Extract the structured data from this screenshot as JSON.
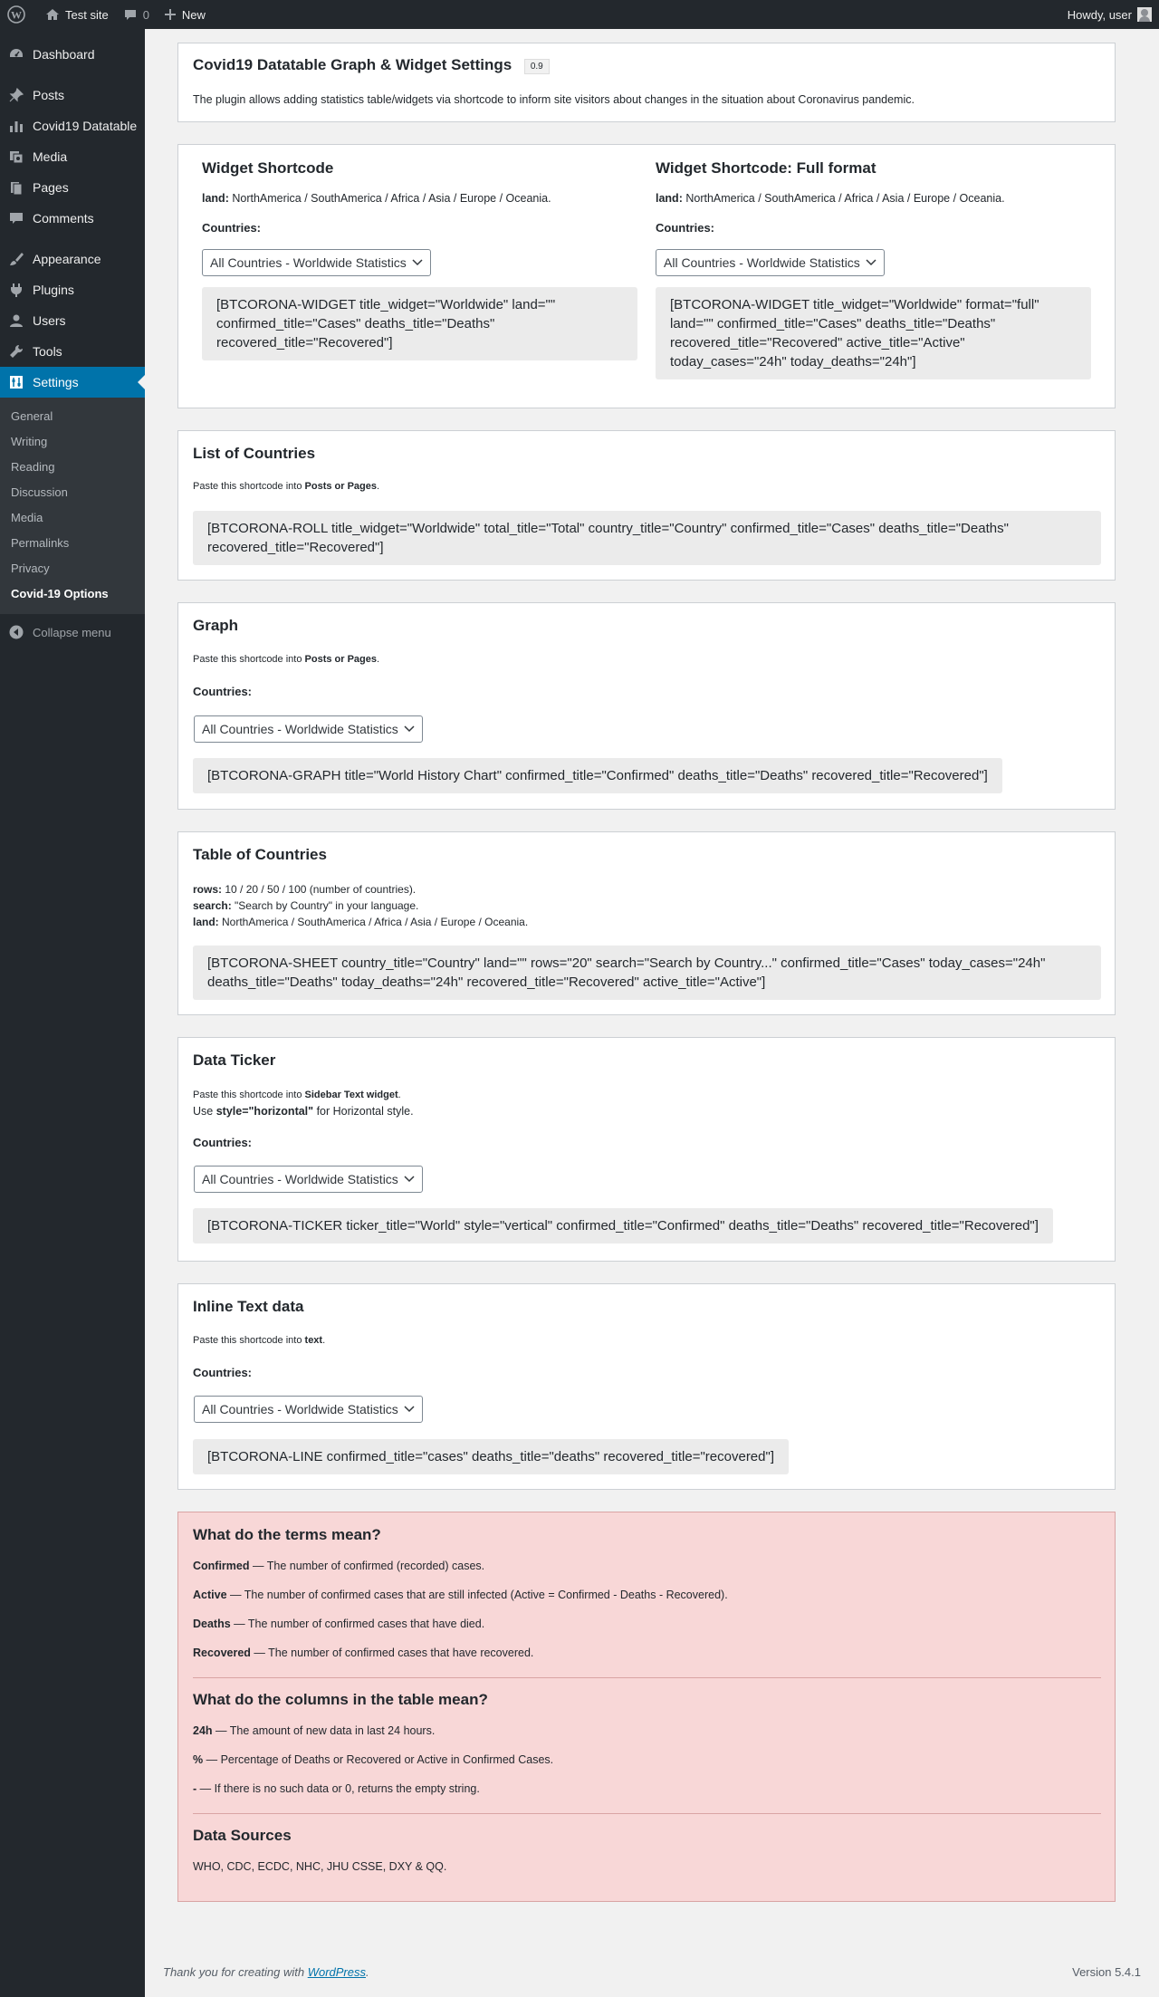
{
  "adminbar": {
    "site_name": "Test site",
    "comments_count": "0",
    "new_label": "New",
    "howdy": "Howdy, user"
  },
  "sidebar": {
    "items": [
      {
        "label": "Dashboard",
        "icon": "dashboard-icon"
      },
      {
        "label": "Posts",
        "icon": "pushpin-icon"
      },
      {
        "label": "Covid19 Datatable",
        "icon": "chart-bar-icon"
      },
      {
        "label": "Media",
        "icon": "media-icon"
      },
      {
        "label": "Pages",
        "icon": "page-icon"
      },
      {
        "label": "Comments",
        "icon": "comment-icon"
      },
      {
        "label": "Appearance",
        "icon": "paintbrush-icon"
      },
      {
        "label": "Plugins",
        "icon": "plugin-icon"
      },
      {
        "label": "Users",
        "icon": "user-icon"
      },
      {
        "label": "Tools",
        "icon": "wrench-icon"
      },
      {
        "label": "Settings",
        "icon": "settings-icon"
      }
    ],
    "submenu": [
      "General",
      "Writing",
      "Reading",
      "Discussion",
      "Media",
      "Permalinks",
      "Privacy",
      "Covid-19 Options"
    ],
    "collapse_label": "Collapse menu"
  },
  "header": {
    "title": "Covid19 Datatable Graph & Widget Settings",
    "version": "0.9",
    "description": "The plugin allows adding statistics table/widgets via shortcode to inform site visitors about changes in the situation about Coronavirus pandemic."
  },
  "common": {
    "land_label": "land:",
    "land_values": "NorthAmerica / SouthAmerica / Africa / Asia / Europe / Oceania.",
    "countries_label": "Countries:",
    "select_value": "All Countries - Worldwide Statistics",
    "paste_prefix": "Paste this shortcode into",
    "posts_or_pages": "Posts or Pages"
  },
  "widget": {
    "title": "Widget Shortcode",
    "code": "[BTCORONA-WIDGET title_widget=\"Worldwide\" land=\"\" confirmed_title=\"Cases\" deaths_title=\"Deaths\" recovered_title=\"Recovered\"]"
  },
  "widget_full": {
    "title": "Widget Shortcode: Full format",
    "code": "[BTCORONA-WIDGET title_widget=\"Worldwide\" format=\"full\" land=\"\" confirmed_title=\"Cases\" deaths_title=\"Deaths\" recovered_title=\"Recovered\" active_title=\"Active\" today_cases=\"24h\" today_deaths=\"24h\"]"
  },
  "roll": {
    "title": "List of Countries",
    "code": "[BTCORONA-ROLL title_widget=\"Worldwide\" total_title=\"Total\" country_title=\"Country\" confirmed_title=\"Cases\" deaths_title=\"Deaths\" recovered_title=\"Recovered\"]"
  },
  "graph": {
    "title": "Graph",
    "code": "[BTCORONA-GRAPH title=\"World History Chart\" confirmed_title=\"Confirmed\" deaths_title=\"Deaths\" recovered_title=\"Recovered\"]"
  },
  "sheet": {
    "title": "Table of Countries",
    "rows_label": "rows:",
    "rows_text": "10 / 20 / 50 / 100 (number of countries).",
    "search_label": "search:",
    "search_text": "\"Search by Country\" in your language.",
    "code": "[BTCORONA-SHEET country_title=\"Country\" land=\"\" rows=\"20\" search=\"Search by Country...\" confirmed_title=\"Cases\" today_cases=\"24h\" deaths_title=\"Deaths\" today_deaths=\"24h\" recovered_title=\"Recovered\" active_title=\"Active\"]"
  },
  "ticker": {
    "title": "Data Ticker",
    "target": "Sidebar Text widget",
    "use_prefix": "Use",
    "use_style": "style=\"horizontal\"",
    "use_suffix": "for Horizontal style.",
    "code": "[BTCORONA-TICKER ticker_title=\"World\" style=\"vertical\" confirmed_title=\"Confirmed\" deaths_title=\"Deaths\" recovered_title=\"Recovered\"]"
  },
  "line": {
    "title": "Inline Text data",
    "target": "text",
    "code": "[BTCORONA-LINE confirmed_title=\"cases\" deaths_title=\"deaths\" recovered_title=\"recovered\"]"
  },
  "terms": {
    "title": "What do the terms mean?",
    "items": [
      {
        "term": "Confirmed",
        "desc": "— The number of confirmed (recorded) cases."
      },
      {
        "term": "Active",
        "desc": "— The number of confirmed cases that are still infected (Active = Confirmed - Deaths - Recovered)."
      },
      {
        "term": "Deaths",
        "desc": "— The number of confirmed cases that have died."
      },
      {
        "term": "Recovered",
        "desc": "— The number of confirmed cases that have recovered."
      }
    ],
    "columns_title": "What do the columns in the table mean?",
    "columns": [
      {
        "term": "24h",
        "desc": "— The amount of new data in last 24 hours."
      },
      {
        "term": "%",
        "desc": "— Percentage of Deaths or Recovered or Active in Confirmed Cases."
      },
      {
        "term": "-",
        "desc": "— If there is no such data or 0, returns the empty string."
      }
    ],
    "sources_title": "Data Sources",
    "sources": "WHO, CDC, ECDC, NHC, JHU CSSE, DXY & QQ."
  },
  "footer": {
    "thanks_prefix": "Thank you for creating with",
    "wordpress": "WordPress",
    "thanks_suffix": ".",
    "version": "Version 5.4.1"
  }
}
